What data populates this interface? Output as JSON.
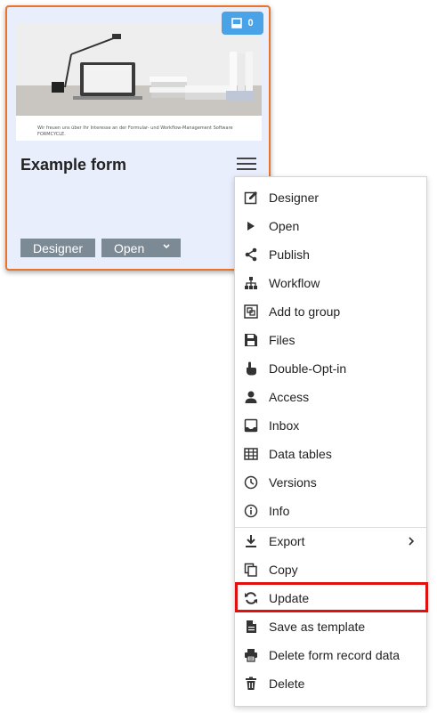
{
  "card": {
    "title": "Example form",
    "inbox_count": "0",
    "thumbnail_text": "Wir freuen uns über Ihr Interesse an der Formular- und Workflow-Management Software FORMCYCLE.",
    "designer_button": "Designer",
    "open_button": "Open"
  },
  "menu": {
    "items": [
      {
        "label": "Designer",
        "icon": "edit-icon"
      },
      {
        "label": "Open",
        "icon": "play-icon"
      },
      {
        "label": "Publish",
        "icon": "share-icon"
      },
      {
        "label": "Workflow",
        "icon": "sitemap-icon"
      },
      {
        "label": "Add to group",
        "icon": "group-add-icon"
      },
      {
        "label": "Files",
        "icon": "save-icon"
      },
      {
        "label": "Double-Opt-in",
        "icon": "hand-pointer-icon"
      },
      {
        "label": "Access",
        "icon": "user-icon"
      },
      {
        "label": "Inbox",
        "icon": "inbox-icon"
      },
      {
        "label": "Data tables",
        "icon": "table-icon"
      },
      {
        "label": "Versions",
        "icon": "clock-icon"
      },
      {
        "label": "Info",
        "icon": "info-icon"
      },
      {
        "label": "Export",
        "icon": "download-icon"
      },
      {
        "label": "Copy",
        "icon": "copy-icon"
      },
      {
        "label": "Update",
        "icon": "refresh-icon"
      },
      {
        "label": "Save as template",
        "icon": "file-icon"
      },
      {
        "label": "Delete form record data",
        "icon": "print-delete-icon"
      },
      {
        "label": "Delete",
        "icon": "trash-icon"
      }
    ],
    "highlighted_item": "Update"
  },
  "colors": {
    "card_border": "#e9742b",
    "card_bg": "#e9eefc",
    "badge": "#4aa3e6",
    "button": "#7c8a96",
    "highlight": "#e01010"
  }
}
